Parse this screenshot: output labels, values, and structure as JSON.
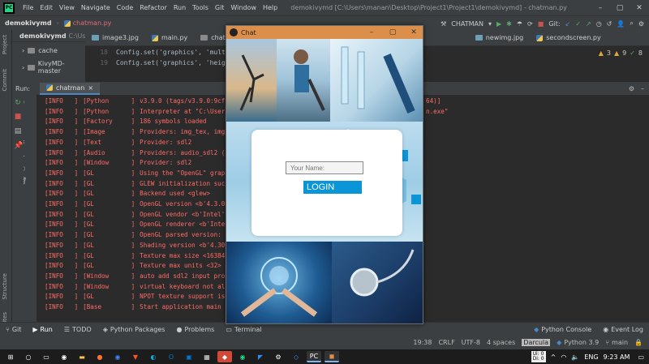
{
  "menubar": {
    "logo": "PC",
    "items": [
      "File",
      "Edit",
      "View",
      "Navigate",
      "Code",
      "Refactor",
      "Run",
      "Tools",
      "Git",
      "Window",
      "Help"
    ],
    "title": "demokivymd [C:\\Users\\manan\\Desktop\\Project1\\Project1\\demokivymd] - chatman.py"
  },
  "navbar": {
    "project": "demokivymd",
    "file": "chatman.py",
    "run_config": "CHATMAN",
    "git_label": "Git:"
  },
  "project_panel": {
    "root": "demokivymd",
    "root_path": "C:\\Use",
    "items": [
      "cache",
      "KivyMD-master"
    ]
  },
  "editor_tabs": [
    "image3.jpg",
    "main.py",
    "chat.kv",
    "newimg.jpg",
    "secondscreen.py"
  ],
  "editor": {
    "lines": [
      {
        "num": "18",
        "code": "Config.set('graphics', 'multi"
      },
      {
        "num": "19",
        "code": "Config.set('graphics', 'heigh"
      }
    ],
    "warnings": "3",
    "errors": "9",
    "weak": "8"
  },
  "run_panel": {
    "label": "Run:",
    "tab": "chatman"
  },
  "console": [
    {
      "lvl": "[INFO   ]",
      "src": "[Python      ]",
      "msg": "v3.9.0 (tags/v3.9.0:9cf",
      "tail": "64)]"
    },
    {
      "lvl": "[INFO   ]",
      "src": "[Python      ]",
      "msg": "Interpreter at \"C:\\User",
      "tail": "n.exe\""
    },
    {
      "lvl": "[INFO   ]",
      "src": "[Factory     ]",
      "msg": "186 symbols loaded",
      "tail": ""
    },
    {
      "lvl": "[INFO   ]",
      "src": "[Image       ]",
      "msg": "Providers: img_tex, img",
      "tail": ""
    },
    {
      "lvl": "[INFO   ]",
      "src": "[Text        ]",
      "msg": "Provider: sdl2",
      "tail": ""
    },
    {
      "lvl": "[INFO   ]",
      "src": "[Audio       ]",
      "msg": "Providers: audio_sdl2 (",
      "tail": ""
    },
    {
      "lvl": "[INFO   ]",
      "src": "[Window      ]",
      "msg": "Provider: sdl2",
      "tail": ""
    },
    {
      "lvl": "[INFO   ]",
      "src": "[GL          ]",
      "msg": "Using the \"OpenGL\" grap",
      "tail": ""
    },
    {
      "lvl": "[INFO   ]",
      "src": "[GL          ]",
      "msg": "GLEW initialization suc",
      "tail": ""
    },
    {
      "lvl": "[INFO   ]",
      "src": "[GL          ]",
      "msg": "Backend used <glew>",
      "tail": ""
    },
    {
      "lvl": "[INFO   ]",
      "src": "[GL          ]",
      "msg": "OpenGL version <b'4.3.0",
      "tail": ""
    },
    {
      "lvl": "[INFO   ]",
      "src": "[GL          ]",
      "msg": "OpenGL vendor <b'Intel'",
      "tail": ""
    },
    {
      "lvl": "[INFO   ]",
      "src": "[GL          ]",
      "msg": "OpenGL renderer <b'Inte",
      "tail": ""
    },
    {
      "lvl": "[INFO   ]",
      "src": "[GL          ]",
      "msg": "OpenGL parsed version: ",
      "tail": ""
    },
    {
      "lvl": "[INFO   ]",
      "src": "[GL          ]",
      "msg": "Shading version <b'4.30",
      "tail": ""
    },
    {
      "lvl": "[INFO   ]",
      "src": "[GL          ]",
      "msg": "Texture max size <16384",
      "tail": ""
    },
    {
      "lvl": "[INFO   ]",
      "src": "[GL          ]",
      "msg": "Texture max units <32>",
      "tail": ""
    },
    {
      "lvl": "[INFO   ]",
      "src": "[Window      ]",
      "msg": "auto add sdl2 input pro",
      "tail": ""
    },
    {
      "lvl": "[INFO   ]",
      "src": "[Window      ]",
      "msg": "virtual keyboard not al",
      "tail": ""
    },
    {
      "lvl": "[INFO   ]",
      "src": "[GL          ]",
      "msg": "NPOT texture support is",
      "tail": ""
    },
    {
      "lvl": "[INFO   ]",
      "src": "[Base        ]",
      "msg": "Start application main ",
      "tail": ""
    }
  ],
  "bottom_tabs": [
    "Git",
    "Run",
    "TODO",
    "Python Packages",
    "Problems",
    "Terminal",
    "Python Console",
    "Event Log"
  ],
  "statusbar": {
    "pos": "19:38",
    "line_sep": "CRLF",
    "enc": "UTF-8",
    "indent": "4 spaces",
    "theme": "Darcula",
    "interp": "Python 3.9",
    "branch": "main"
  },
  "taskbar": {
    "time": "9:23 AM",
    "lang": "ENG",
    "net_up": "Ui: 0",
    "net_down": "Di: 0"
  },
  "chat_window": {
    "title": "Chat",
    "placeholder": "Your Name:",
    "login_label": "LOGIN"
  },
  "colors": {
    "accent": "#dc8f4a",
    "login": "#0a95d6",
    "log": "#ff6b68"
  }
}
